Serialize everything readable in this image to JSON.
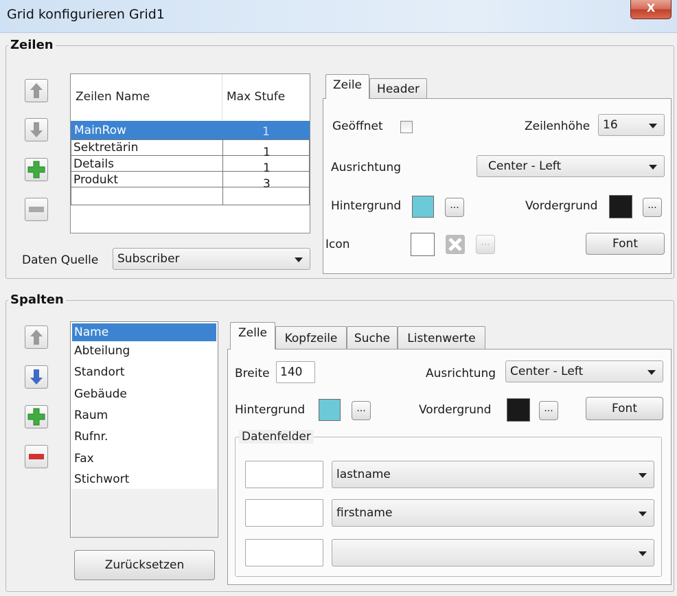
{
  "window": {
    "title": "Grid konfigurieren Grid1",
    "close_label": "X"
  },
  "rows_section": {
    "title": "Zeilen",
    "table": {
      "headers": [
        "Zeilen Name",
        "Max Stufe"
      ],
      "rows": [
        {
          "name": "MainRow",
          "max": "1",
          "selected": true
        },
        {
          "name": "Sektretärin",
          "max": "1"
        },
        {
          "name": "Details",
          "max": "1"
        },
        {
          "name": "Produkt",
          "max": "3"
        }
      ]
    },
    "data_source_label": "Daten Quelle",
    "data_source_value": "Subscriber",
    "tabs": [
      "Zeile",
      "Header"
    ],
    "opened_label": "Geöffnet",
    "row_height_label": "Zeilenhöhe",
    "row_height_value": "16",
    "alignment_label": "Ausrichtung",
    "alignment_value": "Center - Left",
    "background_label": "Hintergrund",
    "foreground_label": "Vordergrund",
    "icon_label": "Icon",
    "font_button": "Font",
    "dots": "...",
    "background_color": "#6cc9d8",
    "foreground_color": "#1a1a1a"
  },
  "columns_section": {
    "title": "Spalten",
    "items": [
      "Name",
      "Abteilung",
      "Standort",
      "Gebäude",
      "Raum",
      "Rufnr.",
      "Fax",
      "Stichwort"
    ],
    "reset_button": "Zurücksetzen",
    "tabs": [
      "Zelle",
      "Kopfzeile",
      "Suche",
      "Listenwerte"
    ],
    "width_label": "Breite",
    "width_value": "140",
    "alignment_label": "Ausrichtung",
    "alignment_value": "Center - Left",
    "background_label": "Hintergrund",
    "foreground_label": "Vordergrund",
    "font_button": "Font",
    "dots": "...",
    "background_color": "#6cc9d8",
    "foreground_color": "#1a1a1a",
    "datafields": {
      "title": "Datenfelder",
      "rows": [
        {
          "text": "",
          "field": "lastname"
        },
        {
          "text": "",
          "field": "firstname"
        },
        {
          "text": "",
          "field": ""
        }
      ]
    }
  }
}
